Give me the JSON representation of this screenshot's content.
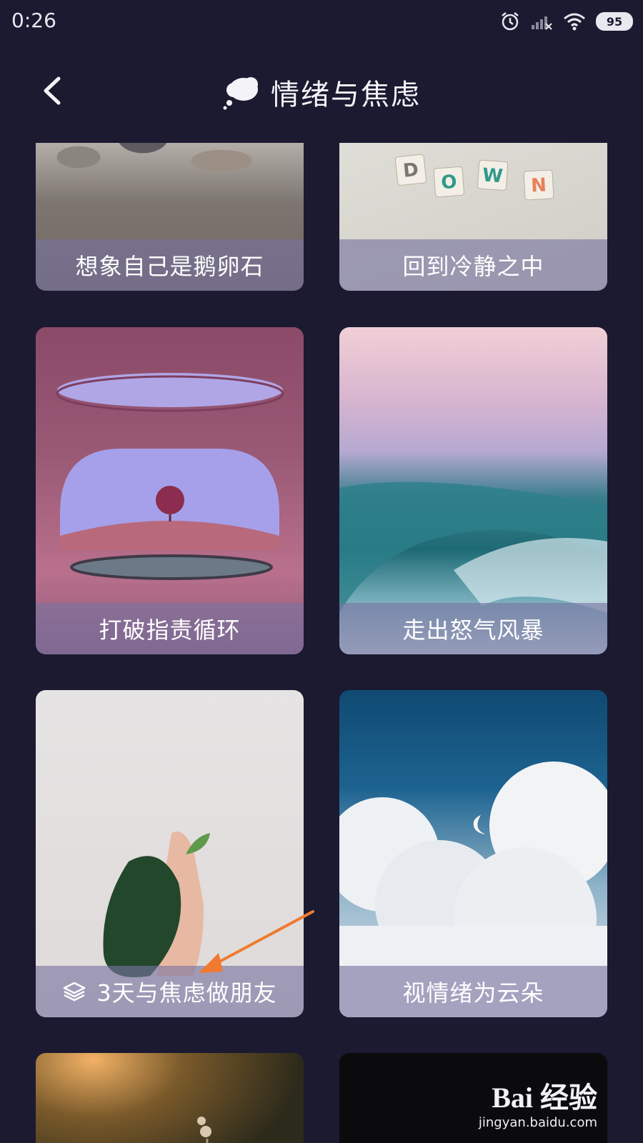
{
  "status_bar": {
    "time": "0:26",
    "battery": "95"
  },
  "header": {
    "title": "情绪与焦虑"
  },
  "cards": [
    {
      "title": "想象自己是鹅卵石"
    },
    {
      "title": "回到冷静之中",
      "image_letters": [
        "D",
        "O",
        "W",
        "N"
      ]
    },
    {
      "title": "打破指责循环"
    },
    {
      "title": "走出怒气风暴"
    },
    {
      "title": "3天与焦虑做朋友"
    },
    {
      "title": "视情绪为云朵"
    }
  ],
  "watermark": {
    "brand": "Bai 经验",
    "url": "jingyan.baidu.com"
  },
  "colors": {
    "background": "#1b1a31",
    "caption_overlay": "#7872a0",
    "annotation_arrow": "#f07a30"
  }
}
